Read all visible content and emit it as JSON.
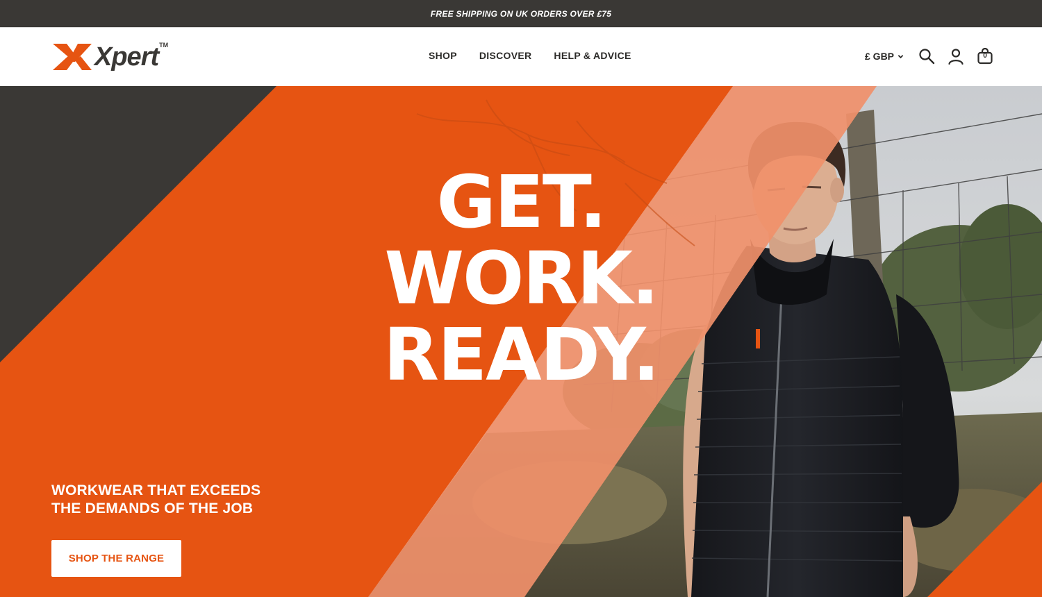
{
  "announcement": {
    "text": "FREE SHIPPING ON UK ORDERS OVER £75"
  },
  "brand": {
    "name": "Xpert",
    "trademark": "TM",
    "accent": "#e65412",
    "dark": "#3a3835"
  },
  "nav": {
    "items": [
      {
        "label": "SHOP"
      },
      {
        "label": "DISCOVER"
      },
      {
        "label": "HELP & ADVICE"
      }
    ]
  },
  "header": {
    "currency": "£ GBP",
    "icons": [
      "search-icon",
      "account-icon",
      "cart-icon"
    ],
    "cart_count": "0"
  },
  "hero": {
    "headline": [
      "GET.",
      "WORK.",
      "READY."
    ],
    "tagline_line1": "WORKWEAR THAT EXCEEDS",
    "tagline_line2": "THE DEMANDS OF THE JOB",
    "cta_label": "SHOP THE RANGE"
  }
}
